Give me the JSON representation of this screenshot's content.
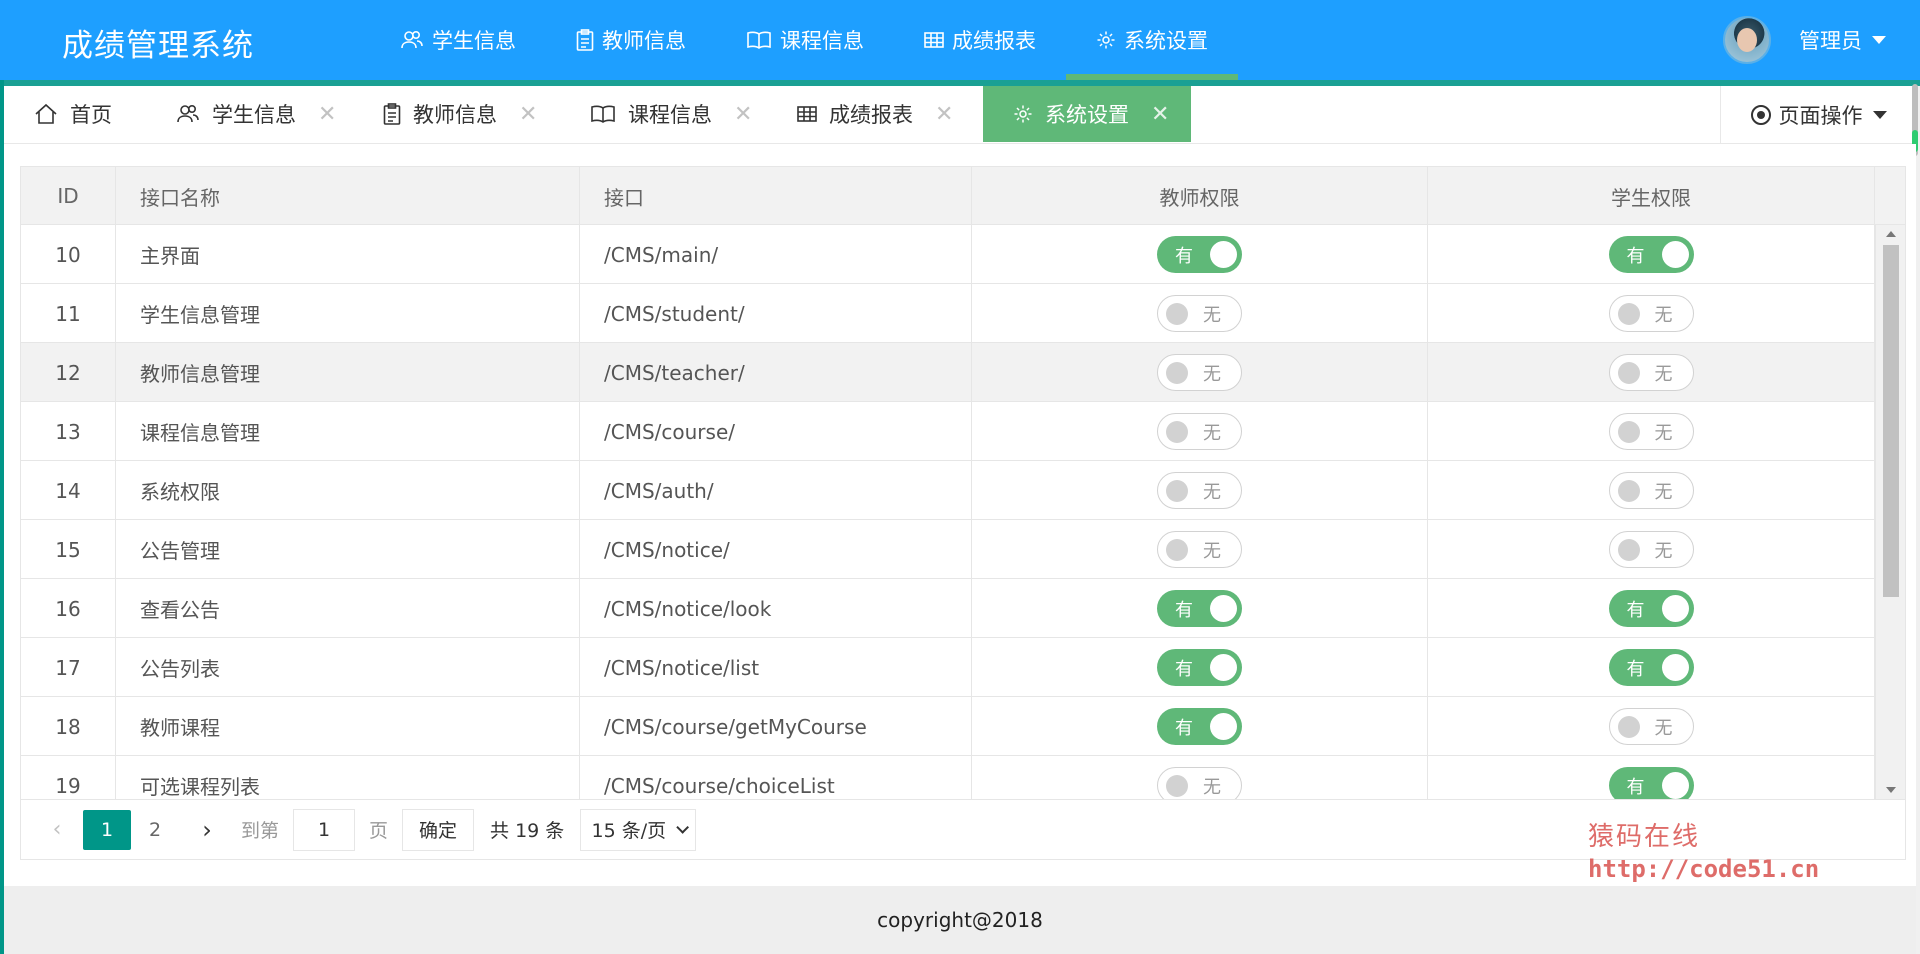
{
  "app": {
    "title": "成绩管理系统",
    "user_name": "管理员"
  },
  "nav": [
    {
      "label": "学生信息",
      "icon": "users-icon"
    },
    {
      "label": "教师信息",
      "icon": "clipboard-icon"
    },
    {
      "label": "课程信息",
      "icon": "book-icon"
    },
    {
      "label": "成绩报表",
      "icon": "table-icon"
    },
    {
      "label": "系统设置",
      "icon": "gear-icon"
    }
  ],
  "tabs": {
    "home": "首页",
    "items": [
      "学生信息",
      "教师信息",
      "课程信息",
      "成绩报表",
      "系统设置"
    ],
    "close_glyph": "✕",
    "page_ops": "页面操作"
  },
  "table": {
    "headers": {
      "id": "ID",
      "name": "接口名称",
      "api": "接口",
      "teacher": "教师权限",
      "student": "学生权限"
    },
    "rows": [
      {
        "id": "10",
        "name": "主界面",
        "api": "/CMS/main/",
        "teacher": "有",
        "student": "有"
      },
      {
        "id": "11",
        "name": "学生信息管理",
        "api": "/CMS/student/",
        "teacher": "无",
        "student": "无"
      },
      {
        "id": "12",
        "name": "教师信息管理",
        "api": "/CMS/teacher/",
        "teacher": "无",
        "student": "无"
      },
      {
        "id": "13",
        "name": "课程信息管理",
        "api": "/CMS/course/",
        "teacher": "无",
        "student": "无"
      },
      {
        "id": "14",
        "name": "系统权限",
        "api": "/CMS/auth/",
        "teacher": "无",
        "student": "无"
      },
      {
        "id": "15",
        "name": "公告管理",
        "api": "/CMS/notice/",
        "teacher": "无",
        "student": "无"
      },
      {
        "id": "16",
        "name": "查看公告",
        "api": "/CMS/notice/look",
        "teacher": "有",
        "student": "有"
      },
      {
        "id": "17",
        "name": "公告列表",
        "api": "/CMS/notice/list",
        "teacher": "有",
        "student": "有"
      },
      {
        "id": "18",
        "name": "教师课程",
        "api": "/CMS/course/getMyCourse",
        "teacher": "有",
        "student": "无"
      },
      {
        "id": "19",
        "name": "可选课程列表",
        "api": "/CMS/course/choiceList",
        "teacher": "无",
        "student": "有"
      }
    ]
  },
  "pager": {
    "prev": "‹",
    "pages": [
      "1",
      "2"
    ],
    "next": "›",
    "goto_prefix": "到第",
    "goto_value": "1",
    "goto_suffix": "页",
    "confirm": "确定",
    "total": "共 19 条",
    "page_size": "15 条/页"
  },
  "watermark": {
    "line1": "猿码在线",
    "line2": "http://code51.cn"
  },
  "footer": "copyright@2018",
  "colors": {
    "header": "#1e9fff",
    "active_tab": "#5fb878",
    "switch_on": "#5fb878",
    "page_active": "#009688"
  }
}
